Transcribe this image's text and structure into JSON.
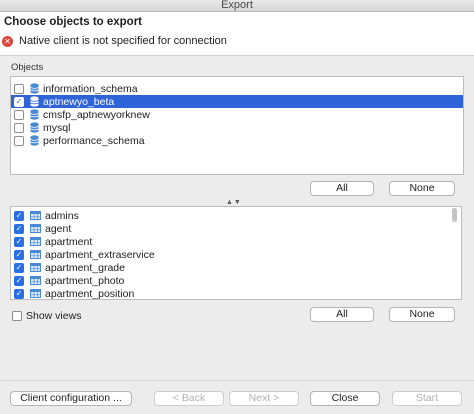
{
  "window": {
    "title": "Export"
  },
  "header": {
    "title": "Choose objects to export",
    "error_message": "Native client is not specified for connection"
  },
  "objects_group": {
    "label": "Objects",
    "databases": [
      {
        "name": "information_schema",
        "checked": false,
        "selected": false
      },
      {
        "name": "aptnewyo_beta",
        "checked": true,
        "selected": true
      },
      {
        "name": "cmsfp_aptnewyorknew",
        "checked": false,
        "selected": false
      },
      {
        "name": "mysql",
        "checked": false,
        "selected": false
      },
      {
        "name": "performance_schema",
        "checked": false,
        "selected": false
      }
    ],
    "all_label": "All",
    "none_label": "None"
  },
  "tables_group": {
    "tables": [
      {
        "name": "admins",
        "checked": true
      },
      {
        "name": "agent",
        "checked": true
      },
      {
        "name": "apartment",
        "checked": true
      },
      {
        "name": "apartment_extraservice",
        "checked": true
      },
      {
        "name": "apartment_grade",
        "checked": true
      },
      {
        "name": "apartment_photo",
        "checked": true
      },
      {
        "name": "apartment_position",
        "checked": true
      },
      {
        "name": "",
        "checked": true
      }
    ],
    "show_views_label": "Show views",
    "show_views_checked": false,
    "all_label": "All",
    "none_label": "None"
  },
  "footer": {
    "client_config_label": "Client configuration ...",
    "back_label": "< Back",
    "next_label": "Next >",
    "close_label": "Close",
    "start_label": "Start"
  },
  "colors": {
    "selection": "#2f63d8",
    "checkbox_checked": "#2c6fe3",
    "error_icon": "#d9473e",
    "db_icon": "#4a8ad4",
    "table_icon": "#4a8ad4"
  }
}
